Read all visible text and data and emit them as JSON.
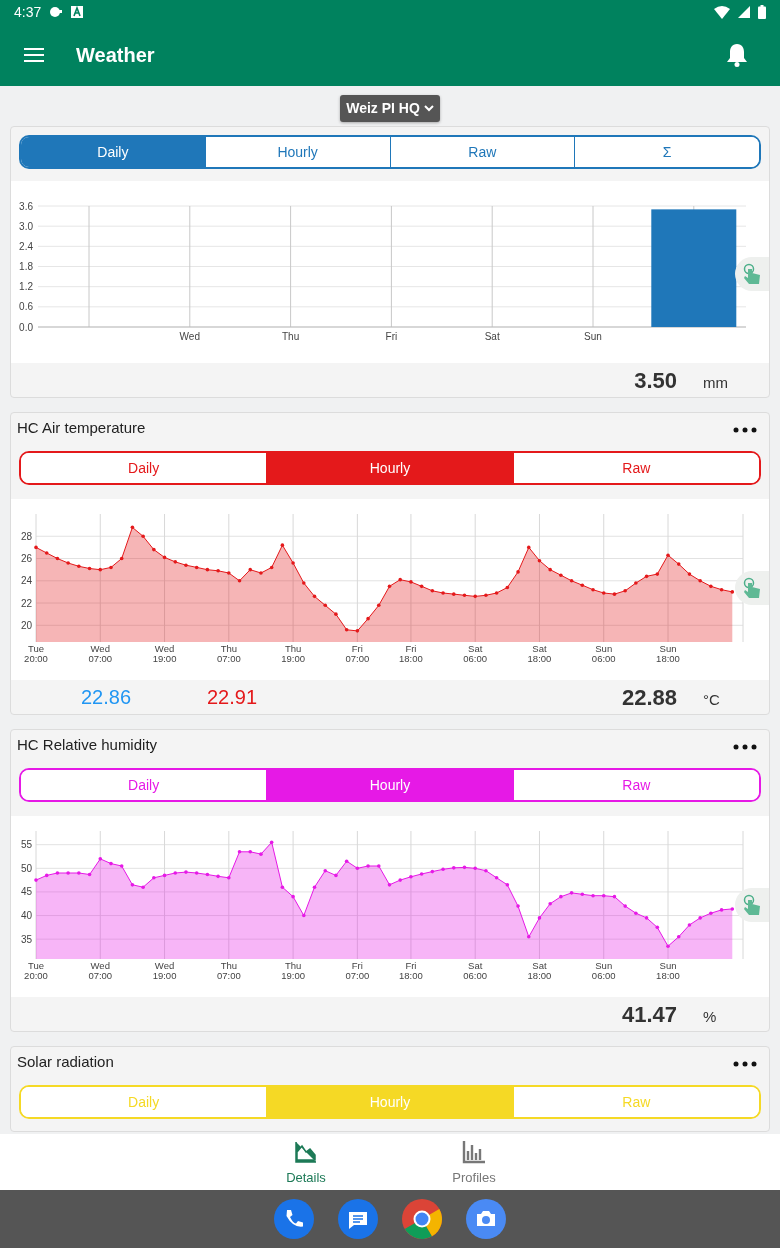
{
  "status_bar": {
    "time": "4:37"
  },
  "app_bar": {
    "title": "Weather"
  },
  "station_picker": {
    "label": "Weiz PI HQ"
  },
  "cards": [
    {
      "color": "#1f77b9",
      "tabs": [
        {
          "label": "Daily",
          "selected": true
        },
        {
          "label": "Hourly",
          "selected": false
        },
        {
          "label": "Raw",
          "selected": false
        },
        {
          "label": "Σ",
          "selected": false
        }
      ],
      "chart_data": {
        "type": "bar",
        "grid": true,
        "categories": [
          null,
          "Wed",
          "Thu",
          "Fri",
          "Sat",
          "Sun",
          null
        ],
        "ylim": [
          0,
          3.6
        ],
        "yticks": [
          {
            "value": 0,
            "label": "0.0"
          },
          {
            "value": 0.6,
            "label": "0.6"
          },
          {
            "value": 1.2,
            "label": "1.2"
          },
          {
            "value": 1.8,
            "label": "1.8"
          },
          {
            "value": 2.4,
            "label": "2.4"
          },
          {
            "value": 3,
            "label": "3.0"
          },
          {
            "value": 3.6,
            "label": "3.6"
          }
        ],
        "series": [
          {
            "color": "#1f77b9",
            "values": [
              0,
              0,
              0,
              0,
              0,
              0,
              3.5
            ]
          }
        ]
      },
      "readings": [
        {
          "kind": "current",
          "text": "3.50"
        }
      ],
      "unit": "mm"
    },
    {
      "title": "HC Air temperature",
      "color": "#e4191b",
      "tabs": [
        {
          "label": "Daily",
          "selected": false
        },
        {
          "label": "Hourly",
          "selected": true
        },
        {
          "label": "Raw",
          "selected": false
        }
      ],
      "chart_data": {
        "type": "area",
        "grid": true,
        "ylim": [
          18.5,
          30
        ],
        "yticks": [
          20,
          22,
          24,
          26,
          28
        ],
        "categories": [
          "Tue 20:00",
          null,
          null,
          null,
          null,
          null,
          "Wed 07:00",
          null,
          null,
          null,
          null,
          null,
          "Wed 19:00",
          null,
          null,
          null,
          null,
          null,
          "Thu 07:00",
          null,
          null,
          null,
          null,
          null,
          "Thu 19:00",
          null,
          null,
          null,
          null,
          null,
          "Fri 07:00",
          null,
          null,
          null,
          null,
          "Fri 18:00",
          null,
          null,
          null,
          null,
          null,
          "Sat 06:00",
          null,
          null,
          null,
          null,
          null,
          "Sat 18:00",
          null,
          null,
          null,
          null,
          null,
          "Sun 06:00",
          null,
          null,
          null,
          null,
          null,
          "Sun 18:00",
          null,
          null,
          null,
          null,
          null,
          null,
          null
        ],
        "series": [
          {
            "color": "#e4191b",
            "values": [
              27.0,
              26.5,
              26.0,
              25.6,
              25.3,
              25.1,
              25.0,
              25.2,
              26.0,
              28.8,
              28.0,
              26.8,
              26.1,
              25.7,
              25.4,
              25.2,
              25.0,
              24.9,
              24.7,
              24.0,
              25.0,
              24.7,
              25.2,
              27.2,
              25.6,
              23.8,
              22.6,
              21.8,
              21.0,
              19.6,
              19.5,
              20.6,
              21.8,
              23.5,
              24.1,
              23.9,
              23.5,
              23.1,
              22.9,
              22.8,
              22.7,
              22.6,
              22.7,
              22.9,
              23.4,
              24.8,
              27.0,
              25.8,
              25.0,
              24.5,
              24.0,
              23.6,
              23.2,
              22.9,
              22.8,
              23.1,
              23.8,
              24.4,
              24.6,
              26.3,
              25.5,
              24.6,
              24.0,
              23.5,
              23.2,
              23.0,
              null
            ]
          }
        ]
      },
      "readings": [
        {
          "kind": "low",
          "text": "22.86"
        },
        {
          "kind": "high",
          "text": "22.91"
        },
        {
          "kind": "current",
          "text": "22.88"
        }
      ],
      "unit": "°C"
    },
    {
      "title": "HC Relative humidity",
      "color": "#e619e6",
      "tabs": [
        {
          "label": "Daily",
          "selected": false
        },
        {
          "label": "Hourly",
          "selected": true
        },
        {
          "label": "Raw",
          "selected": false
        }
      ],
      "chart_data": {
        "type": "area",
        "grid": true,
        "ylim": [
          30.8,
          57.9
        ],
        "yticks": [
          35,
          40,
          45,
          50,
          55
        ],
        "categories": [
          "Tue 20:00",
          null,
          null,
          null,
          null,
          null,
          "Wed 07:00",
          null,
          null,
          null,
          null,
          null,
          "Wed 19:00",
          null,
          null,
          null,
          null,
          null,
          "Thu 07:00",
          null,
          null,
          null,
          null,
          null,
          "Thu 19:00",
          null,
          null,
          null,
          null,
          null,
          "Fri 07:00",
          null,
          null,
          null,
          null,
          "Fri 18:00",
          null,
          null,
          null,
          null,
          null,
          "Sat 06:00",
          null,
          null,
          null,
          null,
          null,
          "Sat 18:00",
          null,
          null,
          null,
          null,
          null,
          "Sun 06:00",
          null,
          null,
          null,
          null,
          null,
          "Sun 18:00",
          null,
          null,
          null,
          null,
          null,
          null,
          null
        ],
        "series": [
          {
            "color": "#e619e6",
            "values": [
              47.5,
              48.5,
              49,
              49,
              49,
              48.7,
              52,
              51,
              50.5,
              46.5,
              46,
              48,
              48.5,
              49,
              49.2,
              49,
              48.7,
              48.3,
              48,
              53.5,
              53.5,
              53,
              55.5,
              46,
              44,
              40,
              46,
              49.5,
              48.5,
              51.5,
              50,
              50.5,
              50.5,
              46.5,
              47.5,
              48.2,
              48.8,
              49.3,
              49.8,
              50.1,
              50.2,
              50,
              49.5,
              48,
              46.5,
              42,
              35.5,
              39.5,
              42.5,
              44,
              44.8,
              44.5,
              44.2,
              44.2,
              44,
              42,
              40.5,
              39.5,
              37.5,
              33.5,
              35.5,
              38,
              39.5,
              40.5,
              41.2,
              41.4,
              null
            ]
          }
        ]
      },
      "readings": [
        {
          "kind": "current",
          "text": "41.47"
        }
      ],
      "unit": "%"
    },
    {
      "title": "Solar radiation",
      "color": "#f5d925",
      "tabs": [
        {
          "label": "Daily",
          "selected": false
        },
        {
          "label": "Hourly",
          "selected": true
        },
        {
          "label": "Raw",
          "selected": false
        }
      ]
    }
  ],
  "bottom_nav": [
    {
      "kind": "area",
      "label": "Details",
      "selected": true
    },
    {
      "kind": "bars",
      "label": "Profiles",
      "selected": false
    }
  ]
}
